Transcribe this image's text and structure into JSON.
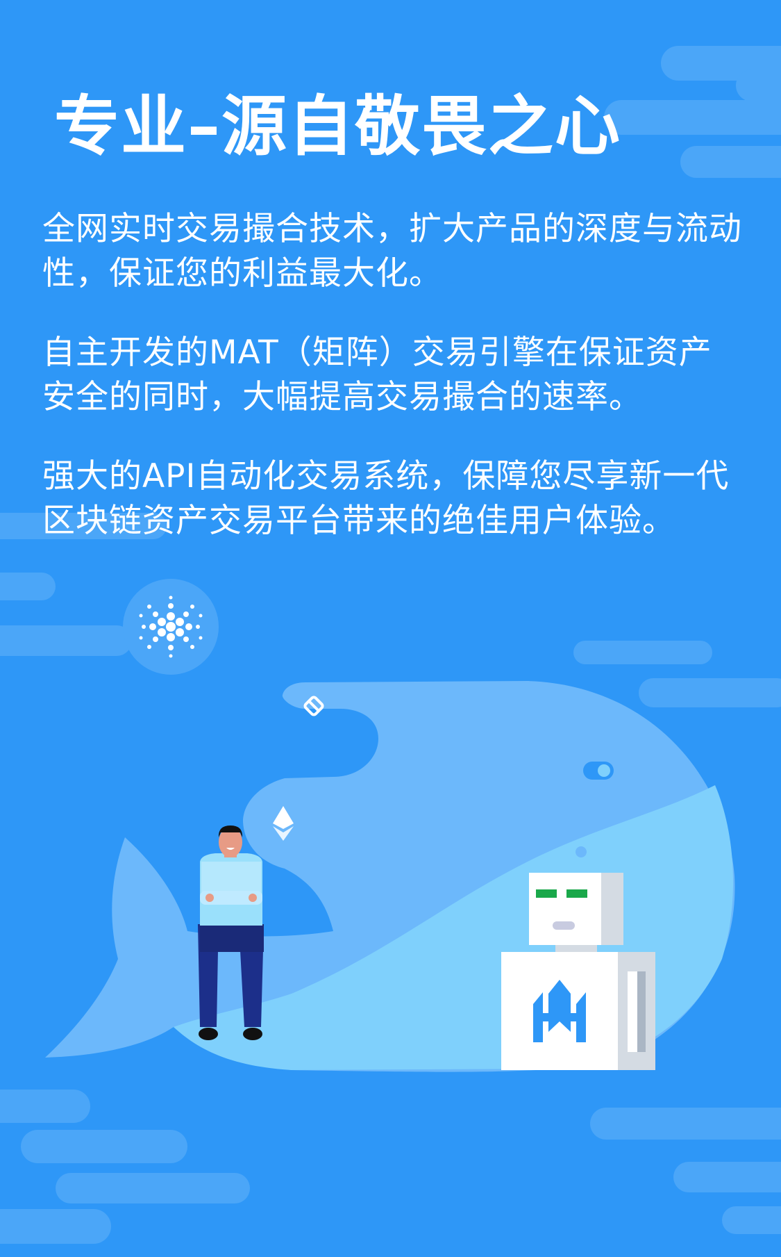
{
  "heading": {
    "title": "专业–源自敬畏之心"
  },
  "paragraphs": [
    "全网实时交易撮合技术，扩大产品的深度与流动性，保证您的利益最大化。",
    "自主开发的MAT（矩阵）交易引擎在保证资产安全的同时，大幅提高交易撮合的速率。",
    "强大的API自动化交易系统，保障您尽享新一代区块链资产交易平台带来的绝佳用户体验。"
  ],
  "colors": {
    "background": "#2e97f7",
    "cloud": "#4ba6f8",
    "whale_body": "#6cb8fb",
    "whale_belly": "#7fd0fc",
    "text": "#ffffff"
  },
  "icons": {
    "cardano": "cardano-coin-icon",
    "ethereum": "ethereum-icon",
    "chain": "chain-link-icon",
    "toggle": "toggle-icon",
    "robot": "robot-icon",
    "person": "person-icon",
    "brand": "h-logo-icon"
  }
}
